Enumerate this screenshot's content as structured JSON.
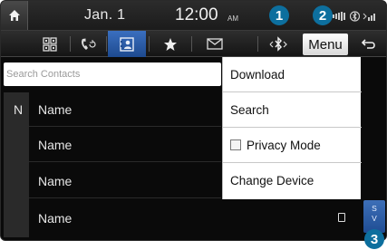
{
  "status": {
    "date": "Jan.  1",
    "time": "12:00",
    "ampm": "AM"
  },
  "toolbar": {
    "tabs": [
      {
        "icon": "dialpad-icon",
        "active": false
      },
      {
        "icon": "recent-calls-icon",
        "active": false
      },
      {
        "icon": "contacts-icon",
        "active": true
      },
      {
        "icon": "favorites-icon",
        "active": false
      },
      {
        "icon": "messages-icon",
        "active": false
      }
    ],
    "bluetooth_icon": "bluetooth-settings-icon",
    "menu_label": "Menu",
    "back_icon": "back-icon"
  },
  "search": {
    "placeholder": "Search Contacts"
  },
  "contacts": {
    "index_letter": "N",
    "rows": [
      "Name",
      "Name",
      "Name",
      "Name"
    ]
  },
  "menu": {
    "items": [
      {
        "label": "Download"
      },
      {
        "label": "Search"
      },
      {
        "label": "Privacy Mode",
        "checkbox": true,
        "checked": false
      },
      {
        "label": "Change Device"
      }
    ]
  },
  "scrollbar": {
    "label_top": "S",
    "label_bottom": "V"
  },
  "callouts": [
    "1",
    "2",
    "3"
  ],
  "colors": {
    "accent": "#1e4a8f",
    "callout": "#0d6f9e",
    "background": "#0a0a0a"
  }
}
